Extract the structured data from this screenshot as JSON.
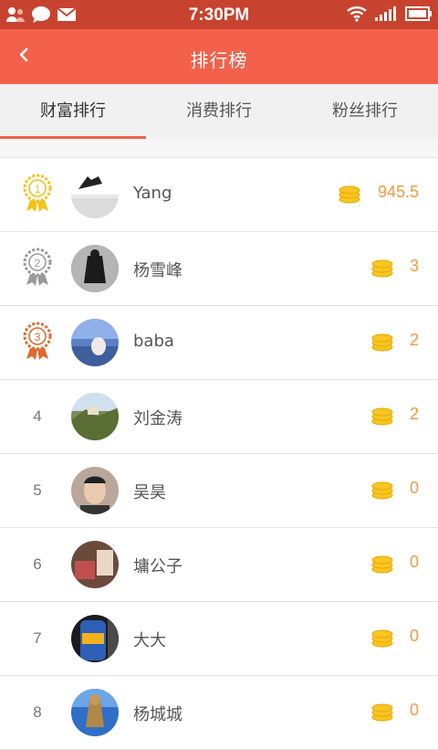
{
  "status_bar": {
    "time": "7:30PM"
  },
  "header": {
    "title": "排行榜"
  },
  "tabs": [
    {
      "label": "财富排行",
      "active": true
    },
    {
      "label": "消费排行",
      "active": false
    },
    {
      "label": "粉丝排行",
      "active": false
    }
  ],
  "colors": {
    "accent": "#f3614a",
    "status_bar": "#c8432f",
    "value": "#f39a3a",
    "gold": "#f2c21b",
    "silver": "#9a9a9a",
    "bronze": "#e0692e"
  },
  "rankings": [
    {
      "rank": "1",
      "medal": "gold-medal-icon",
      "name": "Yang",
      "value": "945.5"
    },
    {
      "rank": "2",
      "medal": "silver-medal-icon",
      "name": "杨雪峰",
      "value": "3"
    },
    {
      "rank": "3",
      "medal": "bronze-medal-icon",
      "name": "baba",
      "value": "2"
    },
    {
      "rank": "4",
      "name": "刘金涛",
      "value": "2"
    },
    {
      "rank": "5",
      "name": "吴昊",
      "value": "0"
    },
    {
      "rank": "6",
      "name": "墉公子",
      "value": "0"
    },
    {
      "rank": "7",
      "name": "大大",
      "value": "0"
    },
    {
      "rank": "8",
      "name": "杨城城",
      "value": "0"
    }
  ]
}
